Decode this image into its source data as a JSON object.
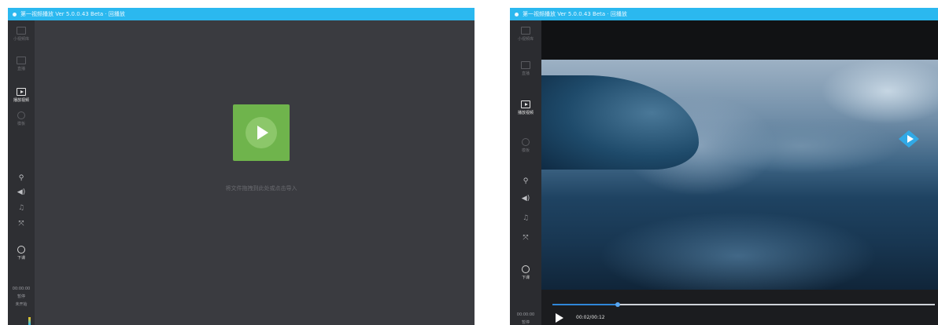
{
  "app": {
    "title": "第一视频播放 Ver 5.0.0.43 Beta · 回播放",
    "accent_color": "#2bb8ef"
  },
  "sidebar": {
    "items": [
      {
        "label": "小视频库",
        "icon": "video-library-icon"
      },
      {
        "label": "直播",
        "icon": "live-icon"
      },
      {
        "label": "播放视频",
        "icon": "play-video-icon",
        "active": true
      },
      {
        "label": "模板",
        "icon": "template-icon"
      }
    ],
    "tools": [
      {
        "icon": "microphone-icon",
        "glyph": "⚲"
      },
      {
        "icon": "volume-icon",
        "glyph": "◀)"
      },
      {
        "icon": "music-note-icon",
        "glyph": "♫"
      },
      {
        "icon": "fullscreen-icon",
        "glyph": "⤧"
      }
    ],
    "timer_label": "下课",
    "status_time": "00:00:00",
    "status_line2": "暂停",
    "status_line3": "未开始"
  },
  "left_panel": {
    "empty_message": "将文件拖拽到此处或点击导入",
    "tile_color": "#6fb44c"
  },
  "right_panel": {
    "current_time": "00:02/00:12",
    "progress": 0.17,
    "status_time": "00:00:00"
  }
}
